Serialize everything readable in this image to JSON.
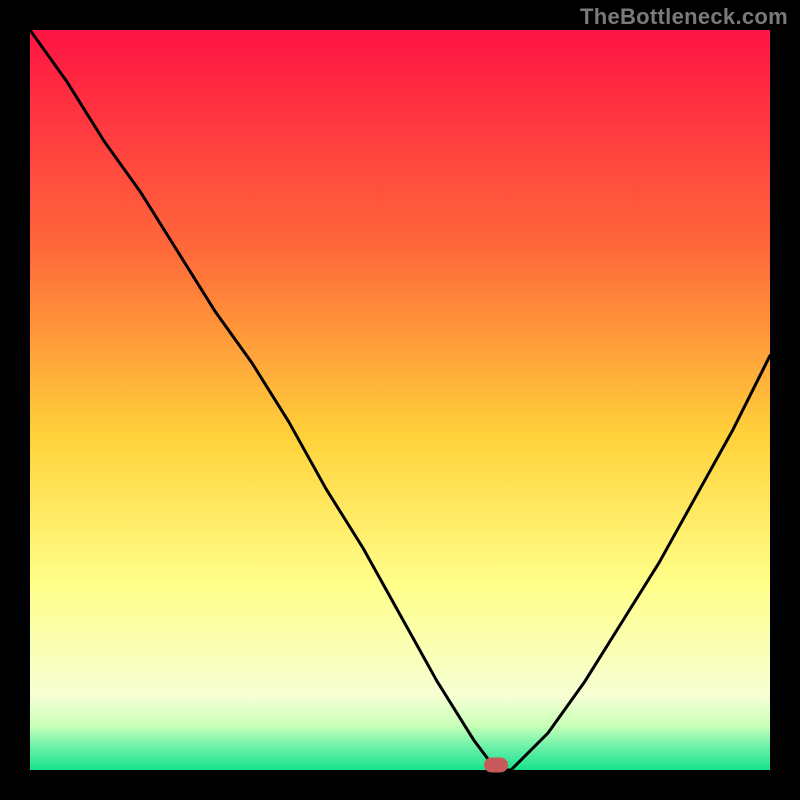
{
  "watermark": "TheBottleneck.com",
  "colors": {
    "red_top": "#ff1444",
    "orange": "#ffa43a",
    "yellow": "#ffe43a",
    "pale_yellow": "#ffffbb",
    "light_green": "#b8ffb0",
    "green": "#18e28c",
    "curve": "#000000",
    "marker": "#c85a5a"
  },
  "chart_data": {
    "type": "line",
    "title": "",
    "xlabel": "",
    "ylabel": "",
    "x": [
      0.0,
      0.05,
      0.1,
      0.15,
      0.2,
      0.25,
      0.3,
      0.35,
      0.4,
      0.45,
      0.5,
      0.55,
      0.6,
      0.63,
      0.65,
      0.7,
      0.75,
      0.8,
      0.85,
      0.9,
      0.95,
      1.0
    ],
    "values": [
      1.0,
      0.93,
      0.85,
      0.78,
      0.7,
      0.62,
      0.55,
      0.47,
      0.38,
      0.3,
      0.21,
      0.12,
      0.04,
      0.0,
      0.0,
      0.05,
      0.12,
      0.2,
      0.28,
      0.37,
      0.46,
      0.56
    ],
    "ylim": [
      0,
      1
    ],
    "xlim": [
      0,
      1
    ],
    "marker": {
      "x": 0.63,
      "y": 0.0
    },
    "gradient_stops": [
      {
        "pos": 0.0,
        "color": "#ff1444"
      },
      {
        "pos": 0.3,
        "color": "#ff6a3a"
      },
      {
        "pos": 0.55,
        "color": "#ffd23a"
      },
      {
        "pos": 0.75,
        "color": "#ffff8a"
      },
      {
        "pos": 0.9,
        "color": "#f7ffd4"
      },
      {
        "pos": 0.94,
        "color": "#c8ffb8"
      },
      {
        "pos": 0.97,
        "color": "#68f0a8"
      },
      {
        "pos": 1.0,
        "color": "#18e28c"
      }
    ]
  }
}
